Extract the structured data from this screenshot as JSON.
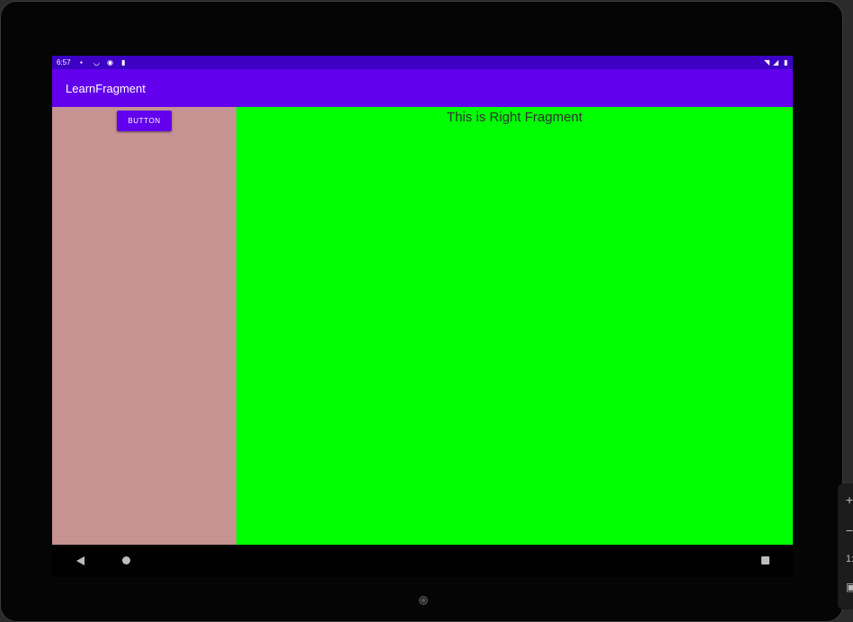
{
  "status_bar": {
    "time": "6:57",
    "left_icons": [
      "notification-icon",
      "wifi-signal-icon",
      "sync-icon",
      "sd-card-icon"
    ],
    "right_icons": [
      "wifi-icon",
      "cell-signal-icon",
      "battery-icon"
    ]
  },
  "app_bar": {
    "title": "LearnFragment"
  },
  "left_fragment": {
    "button_label": "BUTTON",
    "background": "#c69292"
  },
  "right_fragment": {
    "text": "This is Right Fragment",
    "background": "#00ff00"
  },
  "colors": {
    "primary": "#6200ee",
    "primary_dark": "#3d00c4"
  },
  "emulator_controls": {
    "plus": "+",
    "minus": "−",
    "partial": "1:"
  }
}
